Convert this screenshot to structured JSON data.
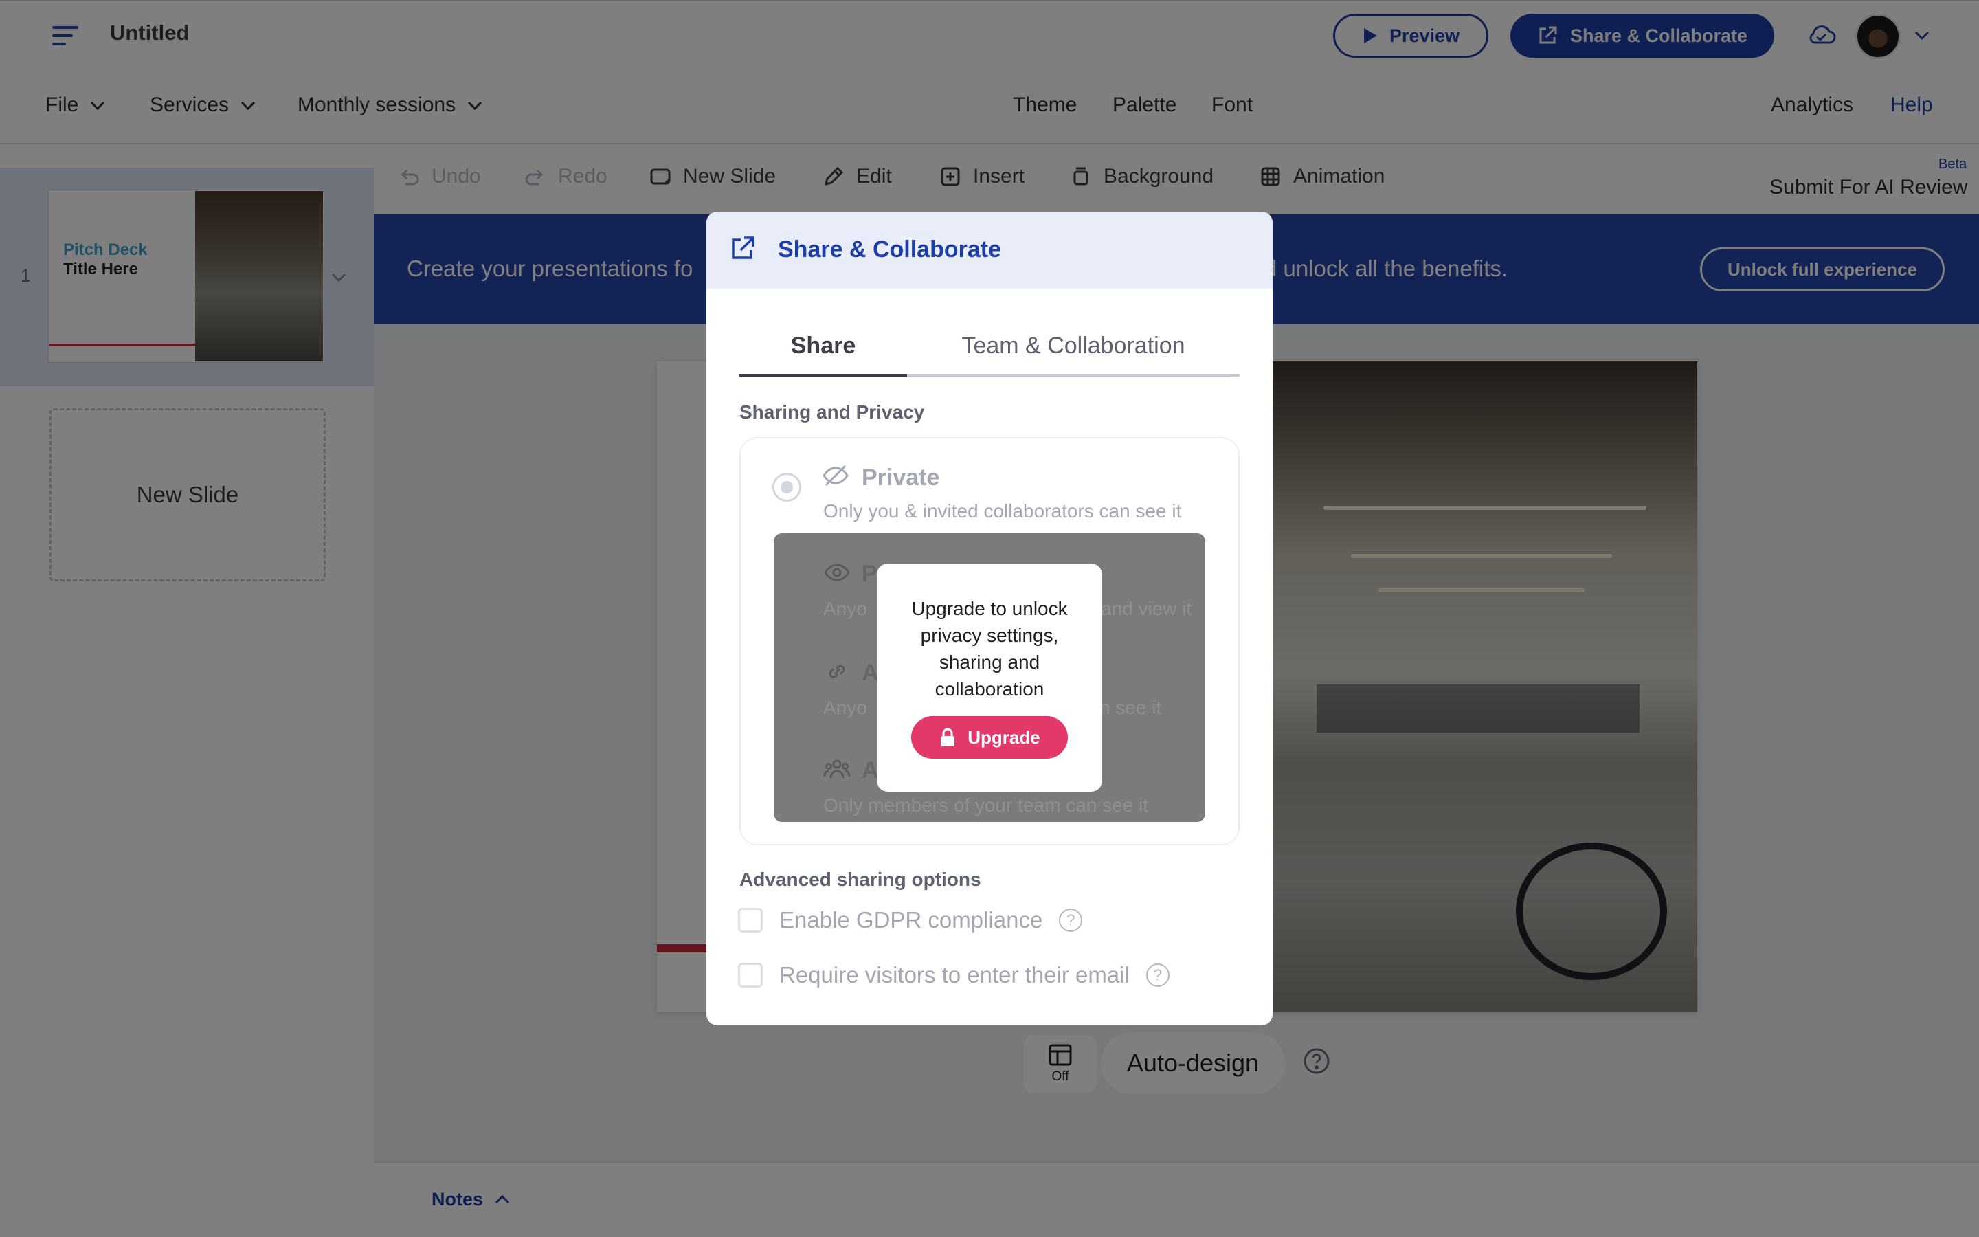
{
  "header": {
    "doc_title": "Untitled",
    "preview_label": "Preview",
    "share_label": "Share & Collaborate"
  },
  "menubar": {
    "file": "File",
    "services": "Services",
    "monthly_sessions": "Monthly sessions",
    "theme": "Theme",
    "palette": "Palette",
    "font": "Font",
    "analytics": "Analytics",
    "help": "Help"
  },
  "slides_panel": {
    "slide_number": "1",
    "thumb_title_line1": "Pitch Deck",
    "thumb_title_line2": "Title Here",
    "new_slide_label": "New Slide"
  },
  "toolbar": {
    "undo": "Undo",
    "redo": "Redo",
    "new_slide": "New Slide",
    "edit": "Edit",
    "insert": "Insert",
    "background": "Background",
    "animation": "Animation",
    "beta": "Beta",
    "ai_review": "Submit For AI Review"
  },
  "banner": {
    "text_left": "Create your presentations fo",
    "text_right": "d unlock all the benefits.",
    "unlock_label": "Unlock full experience"
  },
  "canvas": {
    "autodesign_toggle": "Off",
    "autodesign_label": "Auto-design"
  },
  "notes": {
    "label": "Notes"
  },
  "modal": {
    "title": "Share & Collaborate",
    "tabs": [
      {
        "label": "Share",
        "active": true
      },
      {
        "label": "Team & Collaboration",
        "active": false
      }
    ],
    "sharing_section": "Sharing and Privacy",
    "private_label": "Private",
    "private_desc": "Only you & invited collaborators can see it",
    "locked_rows": [
      {
        "label": "P",
        "desc_left": "Anyo",
        "desc_right": "and view it"
      },
      {
        "label": "A",
        "desc_left": "Anyo",
        "desc_right": "n see it"
      },
      {
        "label": "A",
        "desc_left": "Only members of your team can see it",
        "desc_right": ""
      }
    ],
    "upgrade_text": "Upgrade to unlock privacy settings, sharing and collaboration",
    "upgrade_label": "Upgrade",
    "advanced_section": "Advanced sharing options",
    "gdpr_label": "Enable GDPR compliance",
    "email_label": "Require visitors to enter their email"
  },
  "colors": {
    "brand_blue": "#1e3ea7",
    "banner_blue": "#2846ad",
    "upgrade_pink": "#e2386a"
  }
}
